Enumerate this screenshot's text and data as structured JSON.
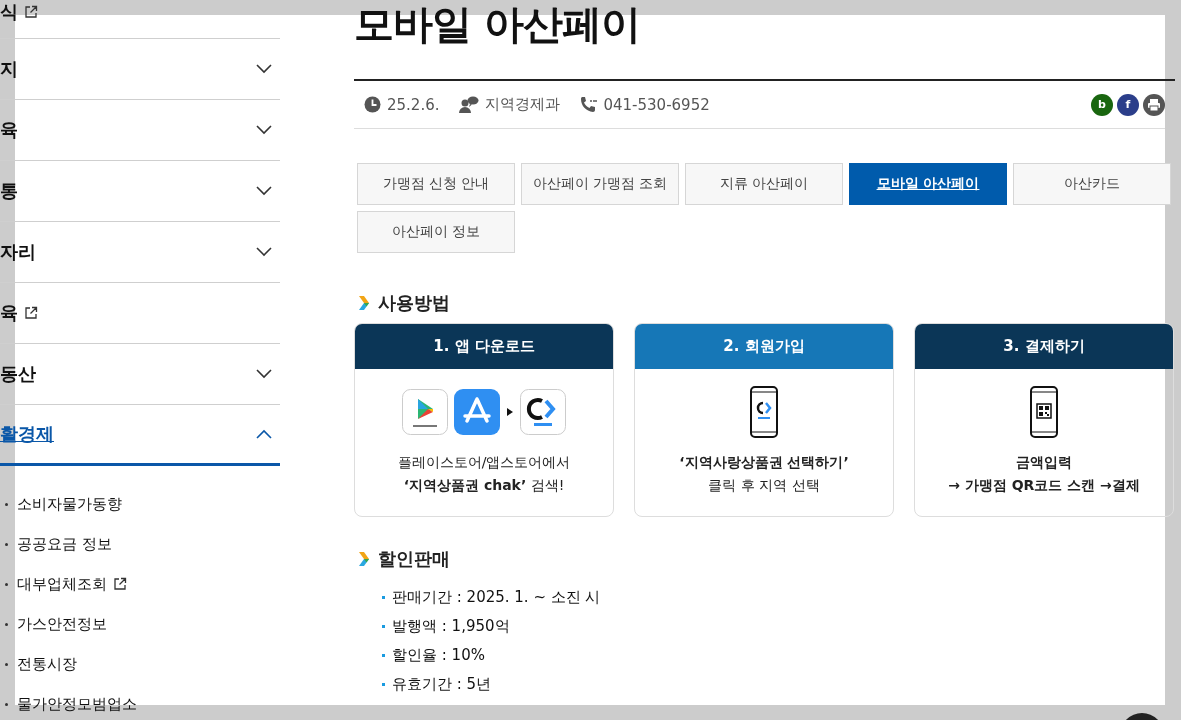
{
  "sidebar": {
    "items": [
      {
        "label": "식",
        "kind": "link",
        "expanded": false
      },
      {
        "label": "지",
        "kind": "expand",
        "expanded": false
      },
      {
        "label": "육",
        "kind": "expand",
        "expanded": false
      },
      {
        "label": "통",
        "kind": "expand",
        "expanded": false
      },
      {
        "label": "자리",
        "kind": "expand",
        "expanded": false
      },
      {
        "label": "육",
        "kind": "link",
        "expanded": false
      },
      {
        "label": "동산",
        "kind": "expand",
        "expanded": false
      },
      {
        "label": "활경제",
        "kind": "expand",
        "expanded": true,
        "children": [
          {
            "label": "소비자물가동향",
            "external": false
          },
          {
            "label": "공공요금 정보",
            "external": false
          },
          {
            "label": "대부업체조회",
            "external": true
          },
          {
            "label": "가스안전정보",
            "external": false
          },
          {
            "label": "전통시장",
            "external": false
          },
          {
            "label": "물가안정모범업소",
            "external": false
          }
        ]
      }
    ]
  },
  "page": {
    "title": "모바일 아산페이",
    "meta": {
      "date": "25.2.6.",
      "department": "지역경제과",
      "phone": "041-530-6952"
    },
    "share": [
      {
        "label": "b",
        "color": "#19660f"
      },
      {
        "label": "f",
        "color": "#2b3e8a"
      }
    ],
    "tabs": [
      {
        "label": "가맹점 신청 안내",
        "selected": false
      },
      {
        "label": "아산페이 가맹점 조회",
        "selected": false
      },
      {
        "label": "지류 아산페이",
        "selected": false
      },
      {
        "label": "모바일 아산페이",
        "selected": true
      },
      {
        "label": "아산카드",
        "selected": false
      },
      {
        "label": "아산페이 정보",
        "selected": false
      }
    ],
    "usage": {
      "heading": "사용방법",
      "steps": [
        {
          "title": "1. 앱 다운로드",
          "color": "#0b3657",
          "kind": "stores",
          "lines": [
            {
              "text": "플레이스토어/앱스토어에서",
              "bold": false
            },
            {
              "text": "**‘지역상품권 chak’** 검색!",
              "bold": false
            }
          ]
        },
        {
          "title": "2. 회원가입",
          "color": "#1677b7",
          "kind": "phone-logo",
          "lines": [
            {
              "text": "‘지역사랑상품권 선택하기’",
              "bold": true
            },
            {
              "text": "클릭 후 지역 선택",
              "bold": false
            }
          ]
        },
        {
          "title": "3. 결제하기",
          "color": "#0b3657",
          "kind": "phone-qr",
          "lines": [
            {
              "text": "금액입력",
              "bold": true
            },
            {
              "text": "→ 가맹점 QR코드 스캔 →결제",
              "bold": true
            }
          ]
        }
      ]
    },
    "sale": {
      "heading": "할인판매",
      "items": [
        "판매기간 : 2025. 1. ~ 소진 시",
        "발행액 : 1,950억",
        "할인율 : 10%",
        "유효기간 : 5년"
      ]
    }
  }
}
